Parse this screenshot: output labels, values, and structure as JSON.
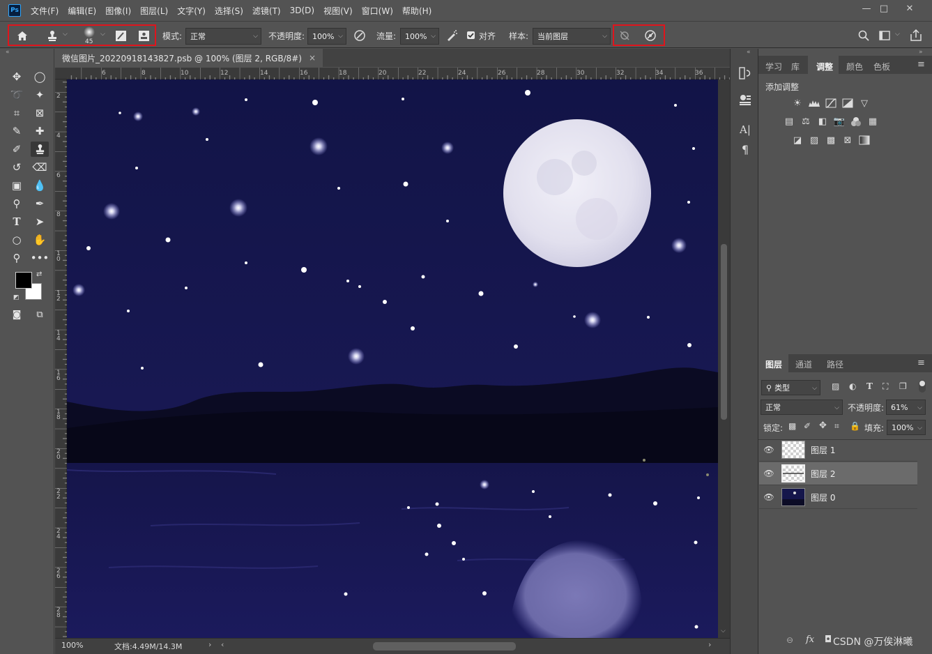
{
  "app": {
    "logo_text": "Ps"
  },
  "menu": [
    "文件(F)",
    "编辑(E)",
    "图像(I)",
    "图层(L)",
    "文字(Y)",
    "选择(S)",
    "滤镜(T)",
    "3D(D)",
    "视图(V)",
    "窗口(W)",
    "帮助(H)"
  ],
  "window_controls": {
    "minimize": "—",
    "restore": "□",
    "close": "✕"
  },
  "options": {
    "brush_size": "45",
    "mode_label": "模式:",
    "mode_value": "正常",
    "opacity_label": "不透明度:",
    "opacity_value": "100%",
    "flow_label": "流量:",
    "flow_value": "100%",
    "align_label": "对齐",
    "align_checked": true,
    "sample_label": "样本:",
    "sample_value": "当前图层"
  },
  "document": {
    "tab_title": "微信图片_20220918143827.psb @ 100% (图层 2, RGB/8#)",
    "close_glyph": "×",
    "zoom": "100%",
    "doc_info": "文档:4.49M/14.3M",
    "ruler_h": [
      "6",
      "8",
      "10",
      "12",
      "14",
      "16",
      "18",
      "20",
      "22",
      "24",
      "26",
      "28",
      "30",
      "32",
      "34",
      "36"
    ],
    "ruler_v": [
      "2",
      "4",
      "6",
      "8",
      "10",
      "12",
      "14",
      "16",
      "18",
      "20",
      "22",
      "24",
      "26",
      "28"
    ]
  },
  "adjust_panel": {
    "tabs": [
      "学习",
      "库",
      "调整",
      "颜色",
      "色板"
    ],
    "active_tab": "调整",
    "title": "添加调整"
  },
  "layers_panel": {
    "tabs": [
      "图层",
      "通道",
      "路径"
    ],
    "active_tab": "图层",
    "filter_label": "类型",
    "blend_mode": "正常",
    "opacity_label": "不透明度:",
    "opacity_value": "61%",
    "lock_label": "锁定:",
    "fill_label": "填充:",
    "fill_value": "100%",
    "layers": [
      {
        "name": "图层 1",
        "visible": true,
        "selected": false
      },
      {
        "name": "图层 2",
        "visible": true,
        "selected": true
      },
      {
        "name": "图层 0",
        "visible": true,
        "selected": false
      }
    ],
    "footer_fx": "fx"
  },
  "watermark": "CSDN @万俟淋曦",
  "colors": {
    "ui_bg": "#535353",
    "night_sky": "#141547",
    "moon": "#e8e6f2",
    "highlight_box": "#e0141c"
  }
}
